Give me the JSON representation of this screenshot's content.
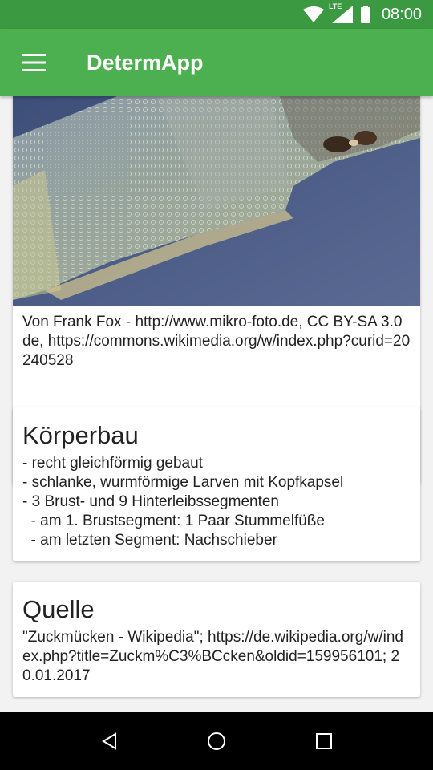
{
  "status_bar": {
    "time": "08:00",
    "network_label": "LTE",
    "icons": [
      "wifi-icon",
      "signal-icon",
      "battery-icon"
    ]
  },
  "app_bar": {
    "title": "DetermApp",
    "menu_icon": "hamburger-menu-icon",
    "color": "#4caf50"
  },
  "image_card": {
    "caption": "Von Frank Fox - http://www.mikro-foto.de, CC BY-SA 3.0 de, https://commons.wikimedia.org/w/index.php?curid=20240528"
  },
  "koerperbau": {
    "title": "Körperbau",
    "lines": [
      "- recht gleichförmig gebaut",
      "- schlanke, wurmförmige Larven mit Kopfkapsel",
      "- 3 Brust- und 9 Hinterleibssegmenten",
      "  - am 1. Brustsegment: 1 Paar Stummelfüße",
      "  - am letzten Segment: Nachschieber"
    ]
  },
  "quelle": {
    "title": "Quelle",
    "text": "\"Zuckmücken - Wikipedia\"; https://de.wikipedia.org/w/index.php?title=Zuckm%C3%BCcken&oldid=159956101; 20.01.2017"
  },
  "nav_bar": {
    "buttons": [
      "back-icon",
      "home-icon",
      "recents-icon"
    ]
  }
}
